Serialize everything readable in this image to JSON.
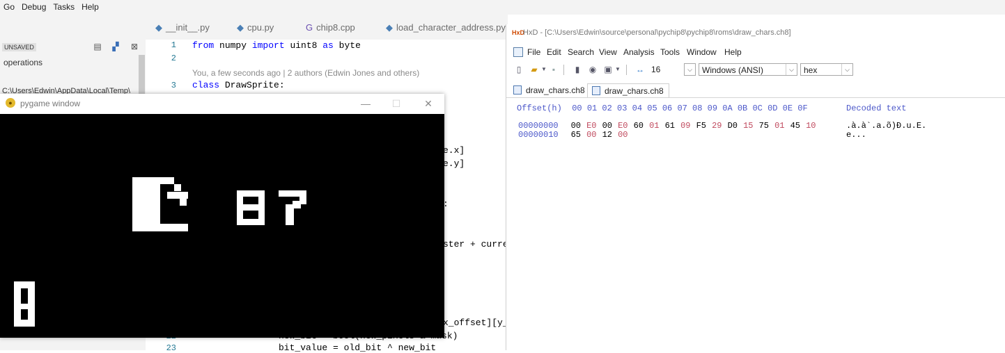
{
  "menubar": [
    "Go",
    "Debug",
    "Tasks",
    "Help"
  ],
  "sidebar": {
    "badge": "UNSAVED",
    "operations": "operations",
    "path": "C:\\Users\\Edwin\\AppData\\Local\\Temp\\"
  },
  "editor": {
    "tabs": [
      "__init__.py",
      "cpu.py",
      "chip8.cpp",
      "load_character_address.py"
    ],
    "tab_icons": [
      "python-icon",
      "python-icon",
      "cpp-icon",
      "python-icon"
    ],
    "lines": [
      {
        "n": "1",
        "code_kw1": "from",
        "code_a": " numpy ",
        "code_kw2": "import",
        "code_b": " uint8 ",
        "code_kw3": "as",
        "code_c": " byte"
      },
      {
        "n": "2"
      },
      {
        "n": "3",
        "code_kw1": "class",
        "code_a": " DrawSprite:"
      }
    ],
    "blame": "You, a few seconds ago | 2 authors (Edwin Jones and others)",
    "fragments": [
      "e.x]",
      "e.y]",
      ":",
      "ster + curre",
      "x_offset][y_",
      "new_bit = bool(new_pixels & mask)",
      "bit_value = old_bit ^ new_bit"
    ],
    "bottom_line_numbers": [
      "22",
      "23"
    ]
  },
  "hxd": {
    "title": "HxD - [C:\\Users\\Edwin\\source\\personal\\pychip8\\pychip8\\roms\\draw_chars.ch8]",
    "menu": [
      "File",
      "Edit",
      "Search",
      "View",
      "Analysis",
      "Tools",
      "Window",
      "Help"
    ],
    "bytes_per_row": "16",
    "charset": "Windows (ANSI)",
    "display_mode": "hex",
    "tabs": [
      "draw_chars.ch8",
      "draw_chars.ch8"
    ],
    "header_offset": "Offset(h)",
    "header_cols": "00 01 02 03 04 05 06 07 08 09 0A 0B 0C 0D 0E 0F",
    "header_decoded": "Decoded text",
    "rows": [
      {
        "offset": "00000000",
        "bytes": [
          "00",
          "E0",
          "00",
          "E0",
          "60",
          "01",
          "61",
          "09",
          "F5",
          "29",
          "D0",
          "15",
          "75",
          "01",
          "45",
          "10"
        ],
        "decoded": ".à.à`.a.õ)Ð.u.E."
      },
      {
        "offset": "00000010",
        "bytes": [
          "65",
          "00",
          "12",
          "00"
        ],
        "decoded": "e..."
      }
    ],
    "colors": {
      "offset": "#4b57c9",
      "alt_byte": "#c04a5e"
    }
  },
  "pygame": {
    "title": "pygame window",
    "buttons": [
      "—",
      "☐",
      "✕"
    ]
  }
}
